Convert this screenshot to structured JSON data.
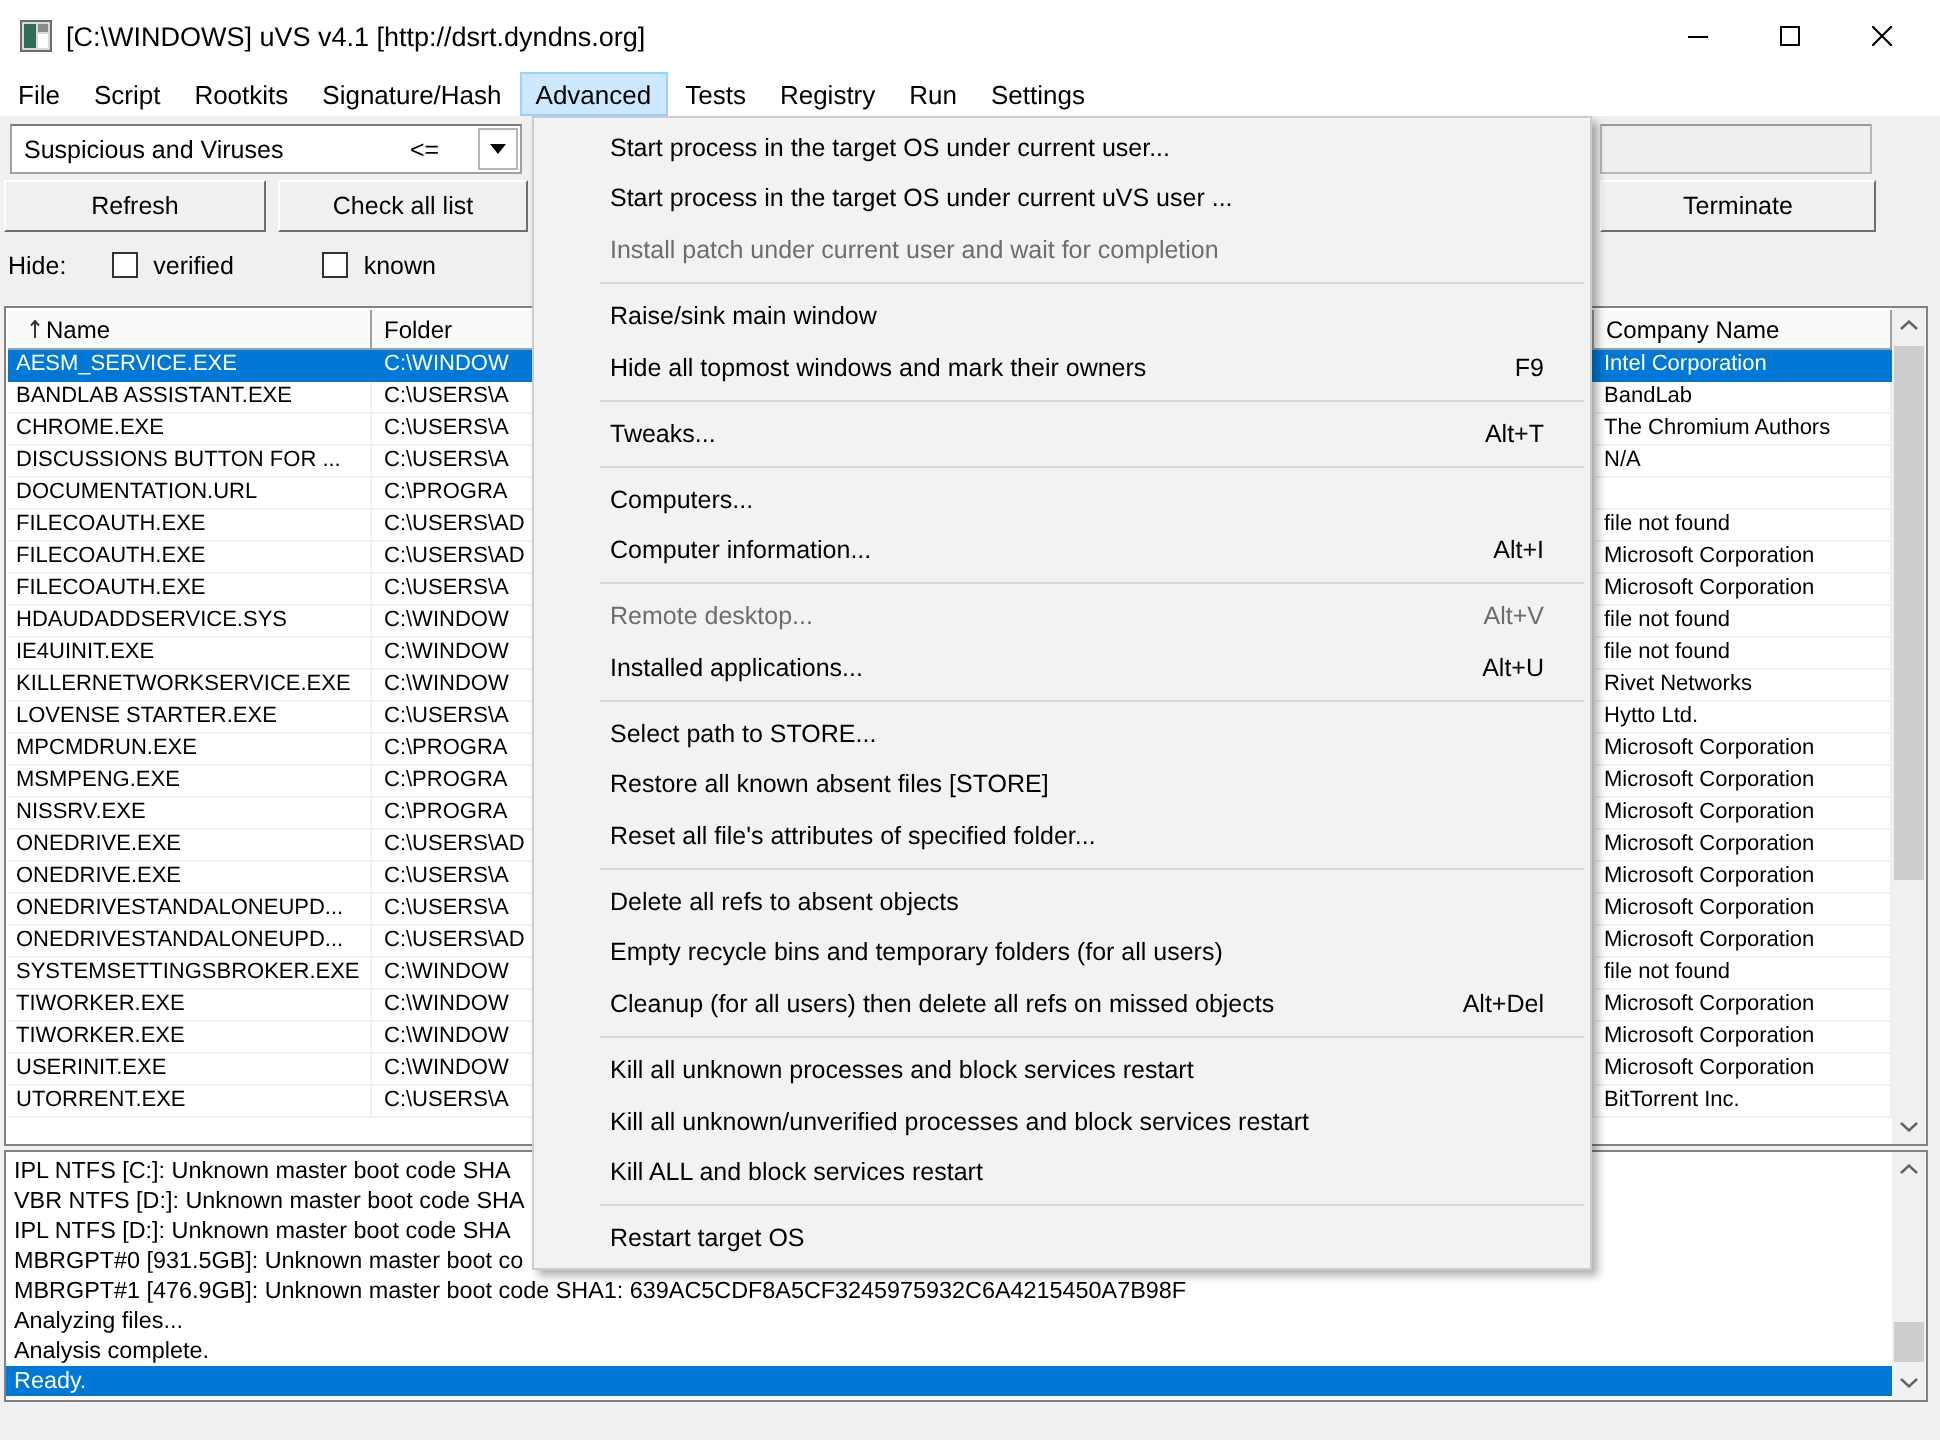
{
  "window": {
    "title": "[C:\\WINDOWS] uVS v4.1 [http://dsrt.dyndns.org]"
  },
  "menu_bar": [
    {
      "label": "File",
      "selected": false
    },
    {
      "label": "Script",
      "selected": false
    },
    {
      "label": "Rootkits",
      "selected": false
    },
    {
      "label": "Signature/Hash",
      "selected": false
    },
    {
      "label": "Advanced",
      "selected": true
    },
    {
      "label": "Tests",
      "selected": false
    },
    {
      "label": "Registry",
      "selected": false
    },
    {
      "label": "Run",
      "selected": false
    },
    {
      "label": "Settings",
      "selected": false
    }
  ],
  "advanced_menu": {
    "groups": [
      {
        "items": [
          {
            "label": "Start process in the target OS under current user...",
            "disabled": false
          },
          {
            "label": "Start process in the target OS under current uVS user ...",
            "disabled": false
          },
          {
            "label": "Install patch under current user and wait for completion",
            "disabled": true
          }
        ]
      },
      {
        "items": [
          {
            "label": "Raise/sink main window",
            "disabled": false
          },
          {
            "label": "Hide all topmost windows and mark their owners",
            "shortcut": "F9",
            "disabled": false
          }
        ]
      },
      {
        "items": [
          {
            "label": "Tweaks...",
            "shortcut": "Alt+T",
            "disabled": false
          }
        ]
      },
      {
        "items": [
          {
            "label": "Computers...",
            "disabled": false
          },
          {
            "label": "Computer information...",
            "shortcut": "Alt+I",
            "disabled": false
          }
        ]
      },
      {
        "items": [
          {
            "label": "Remote desktop...",
            "shortcut": "Alt+V",
            "disabled": true
          },
          {
            "label": "Installed applications...",
            "shortcut": "Alt+U",
            "disabled": false
          }
        ]
      },
      {
        "items": [
          {
            "label": "Select path to STORE...",
            "disabled": false
          },
          {
            "label": "Restore all known absent files [STORE]",
            "disabled": false
          },
          {
            "label": "Reset all file's attributes of specified folder...",
            "disabled": false
          }
        ]
      },
      {
        "items": [
          {
            "label": "Delete all refs to absent objects",
            "disabled": false
          },
          {
            "label": "Empty recycle bins and temporary folders (for all users)",
            "disabled": false
          },
          {
            "label": "Cleanup (for all users) then delete all refs on missed objects",
            "shortcut": "Alt+Del",
            "disabled": false
          }
        ]
      },
      {
        "items": [
          {
            "label": "Kill all unknown processes and block services restart",
            "disabled": false
          },
          {
            "label": "Kill all unknown/unverified processes and block services restart",
            "disabled": false
          },
          {
            "label": "Kill ALL and block services restart",
            "disabled": false
          }
        ]
      },
      {
        "items": [
          {
            "label": "Restart target OS",
            "disabled": false
          }
        ]
      }
    ]
  },
  "filter": {
    "value": "Suspicious and Viruses",
    "operator": "<="
  },
  "buttons": [
    "Refresh",
    "Check all list"
  ],
  "hide": {
    "label": "Hide:",
    "options": [
      {
        "label": "verified",
        "checked": false
      },
      {
        "label": "known",
        "checked": false
      }
    ]
  },
  "side_panel": {
    "button": "Terminate"
  },
  "table": {
    "columns": [
      {
        "label": "Name",
        "sorted": true
      },
      {
        "label": "Folder",
        "sorted": false
      },
      {
        "label": "Company Name",
        "sorted": false
      }
    ],
    "rows": [
      {
        "name": "AESM_SERVICE.EXE",
        "folder": "C:\\WINDOW",
        "company": "Intel Corporation",
        "selected": true
      },
      {
        "name": "BANDLAB ASSISTANT.EXE",
        "folder": "C:\\USERS\\A",
        "company": "BandLab",
        "selected": false
      },
      {
        "name": "CHROME.EXE",
        "folder": "C:\\USERS\\A",
        "company": "The Chromium Authors",
        "selected": false
      },
      {
        "name": "DISCUSSIONS BUTTON FOR ...",
        "folder": "C:\\USERS\\A",
        "company": "N/A",
        "selected": false
      },
      {
        "name": "DOCUMENTATION.URL",
        "folder": "C:\\PROGRA",
        "selected": false
      },
      {
        "name": "FILECOAUTH.EXE",
        "folder": "C:\\USERS\\AD",
        "company": "file not found",
        "selected": false
      },
      {
        "name": "FILECOAUTH.EXE",
        "folder": "C:\\USERS\\AD",
        "company": "Microsoft Corporation",
        "selected": false
      },
      {
        "name": "FILECOAUTH.EXE",
        "folder": "C:\\USERS\\A",
        "company": "Microsoft Corporation",
        "selected": false
      },
      {
        "name": "HDAUDADDSERVICE.SYS",
        "folder": "C:\\WINDOW",
        "company": "file not found",
        "selected": false
      },
      {
        "name": "IE4UINIT.EXE",
        "folder": "C:\\WINDOW",
        "company": "file not found",
        "selected": false
      },
      {
        "name": "KILLERNETWORKSERVICE.EXE",
        "folder": "C:\\WINDOW",
        "company": "Rivet Networks",
        "selected": false
      },
      {
        "name": "LOVENSE STARTER.EXE",
        "folder": "C:\\USERS\\A",
        "company": "Hytto Ltd.",
        "selected": false
      },
      {
        "name": "MPCMDRUN.EXE",
        "folder": "C:\\PROGRA",
        "company": "Microsoft Corporation",
        "selected": false
      },
      {
        "name": "MSMPENG.EXE",
        "folder": "C:\\PROGRA",
        "company": "Microsoft Corporation",
        "selected": false
      },
      {
        "name": "NISSRV.EXE",
        "folder": "C:\\PROGRA",
        "company": "Microsoft Corporation",
        "selected": false
      },
      {
        "name": "ONEDRIVE.EXE",
        "folder": "C:\\USERS\\AD",
        "company": "Microsoft Corporation",
        "selected": false
      },
      {
        "name": "ONEDRIVE.EXE",
        "folder": "C:\\USERS\\A",
        "company": "Microsoft Corporation",
        "selected": false
      },
      {
        "name": "ONEDRIVESTANDALONEUPD...",
        "folder": "C:\\USERS\\A",
        "company": "Microsoft Corporation",
        "selected": false
      },
      {
        "name": "ONEDRIVESTANDALONEUPD...",
        "folder": "C:\\USERS\\AD",
        "company": "Microsoft Corporation",
        "selected": false
      },
      {
        "name": "SYSTEMSETTINGSBROKER.EXE",
        "folder": "C:\\WINDOW",
        "company": "file not found",
        "selected": false
      },
      {
        "name": "TIWORKER.EXE",
        "folder": "C:\\WINDOW",
        "company": "Microsoft Corporation",
        "selected": false
      },
      {
        "name": "TIWORKER.EXE",
        "folder": "C:\\WINDOW",
        "company": "Microsoft Corporation",
        "selected": false
      },
      {
        "name": "USERINIT.EXE",
        "folder": "C:\\WINDOW",
        "company": "Microsoft Corporation",
        "selected": false
      },
      {
        "name": "UTORRENT.EXE",
        "folder": "C:\\USERS\\A",
        "company": "BitTorrent Inc.",
        "selected": false
      }
    ]
  },
  "log": {
    "lines": [
      {
        "text": "IPL NTFS [C:]: Unknown master boot code SHA",
        "selected": false
      },
      {
        "text": "VBR NTFS [D:]: Unknown master boot code SHA",
        "selected": false
      },
      {
        "text": "IPL NTFS [D:]: Unknown master boot code SHA",
        "selected": false
      },
      {
        "text": "MBRGPT#0 [931.5GB]: Unknown master boot co",
        "selected": false
      },
      {
        "text": "MBRGPT#1 [476.9GB]: Unknown master boot code SHA1: 639AC5CDF8A5CF3245975932C6A4215450A7B98F",
        "selected": false
      },
      {
        "text": "Analyzing files...",
        "selected": false
      },
      {
        "text": "Analysis complete.",
        "selected": false
      },
      {
        "text": "Ready.",
        "selected": true
      }
    ]
  }
}
